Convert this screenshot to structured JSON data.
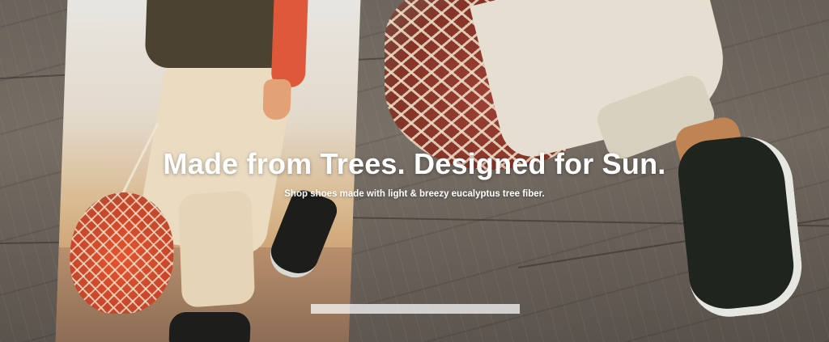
{
  "hero": {
    "headline": "Made from Trees. Designed for Sun.",
    "subheadline": "Shop shoes made with light & breezy eucalyptus tree fiber."
  },
  "colors": {
    "text": "#ffffff",
    "shoe": "#1f241f",
    "bag_fruit": "#c8462b"
  }
}
